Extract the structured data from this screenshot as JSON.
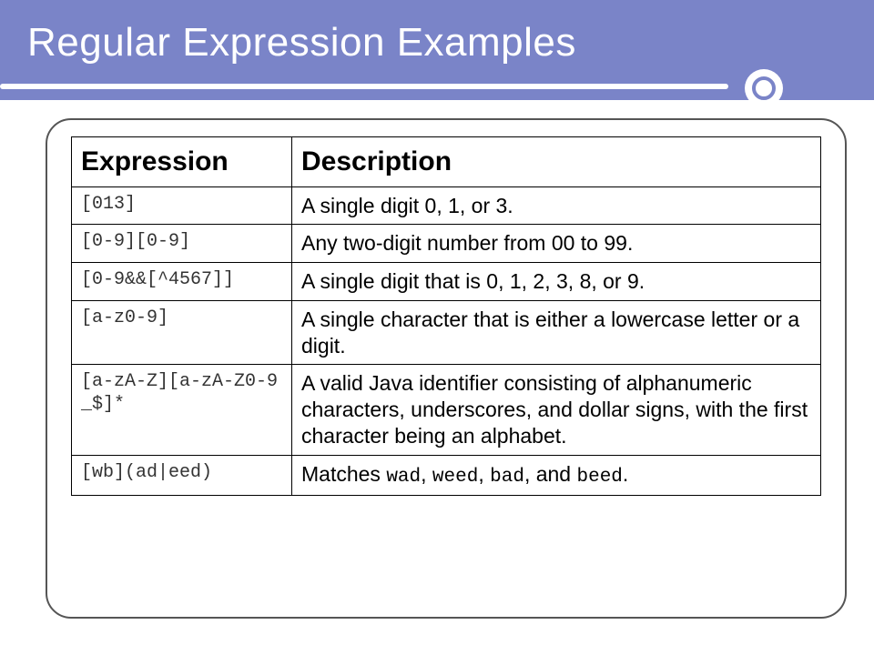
{
  "title": "Regular Expression Examples",
  "headers": {
    "col1": "Expression",
    "col2": "Description"
  },
  "rows": [
    {
      "expr": "[013]",
      "desc": "A single digit 0, 1, or 3."
    },
    {
      "expr": "[0-9][0-9]",
      "desc": "Any two-digit number from 00 to 99."
    },
    {
      "expr": "[0-9&&[^4567]]",
      "desc": "A single digit that is 0, 1, 2, 3, 8, or 9."
    },
    {
      "expr": "[a-z0-9]",
      "desc": "A single character that is either a lowercase letter or a digit."
    },
    {
      "expr": "[a-zA-Z][a-zA-Z0-9_$]*",
      "desc": "A valid Java identifier consisting of alphanumeric characters, underscores, and dollar signs, with the first character being an alphabet."
    },
    {
      "expr": "[wb](ad|eed)",
      "desc_html": "Matches <code>wad</code>, <code>weed</code>, <code>bad</code>, and <code>beed</code>."
    }
  ]
}
